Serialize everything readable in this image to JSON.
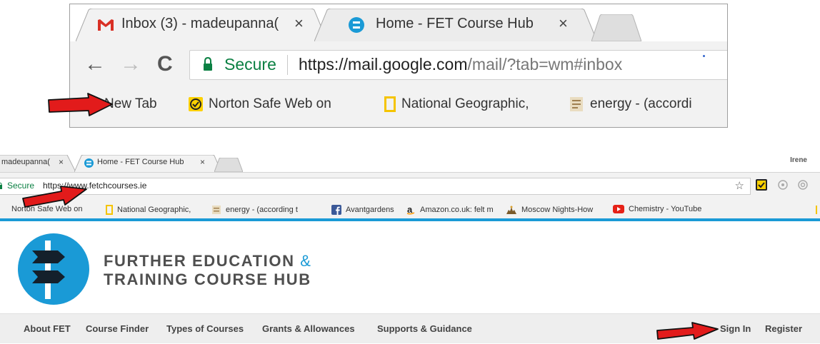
{
  "zoom_browser": {
    "tabs": [
      {
        "icon": "gmail-icon",
        "title": "Inbox (3) - madeupanna(",
        "close": "×"
      },
      {
        "icon": "fet-icon",
        "title": "Home - FET Course Hub",
        "close": "×"
      }
    ],
    "nav": {
      "back": "←",
      "forward": "→",
      "reload": "C"
    },
    "omnibox": {
      "secure_label": "Secure",
      "url_host": "https://mail.google.com",
      "url_path": "/mail/?tab=wm#inbox"
    },
    "bookmarks": [
      {
        "icon": "chrome-icon",
        "label": "New Tab"
      },
      {
        "icon": "norton-icon",
        "label": "Norton Safe Web on"
      },
      {
        "icon": "natgeo-icon",
        "label": "National Geographic,"
      },
      {
        "icon": "book-icon",
        "label": "energy - (accordi"
      }
    ]
  },
  "site_browser": {
    "tabs": [
      {
        "title": "madeupanna(",
        "close": "×"
      },
      {
        "icon": "fet-icon",
        "title": "Home - FET Course Hub",
        "close": "×"
      }
    ],
    "user": "Irene",
    "omnibox": {
      "secure_label": "Secure",
      "url": "https://www.fetchcourses.ie",
      "star": "☆"
    },
    "bookmarks": [
      {
        "label": "Norton Safe Web on"
      },
      {
        "icon": "natgeo-icon",
        "label": "National Geographic,"
      },
      {
        "icon": "book-icon",
        "label": "energy - (according t"
      },
      {
        "icon": "facebook-icon",
        "label": "Avantgardens"
      },
      {
        "icon": "amazon-icon",
        "label": "Amazon.co.uk: felt m"
      },
      {
        "icon": "moscow-icon",
        "label": "Moscow Nights-How"
      },
      {
        "icon": "youtube-icon",
        "label": "Chemistry - YouTube"
      }
    ],
    "brand": {
      "line1": "FURTHER EDUCATION",
      "amp": "&",
      "line2": "TRAINING COURSE HUB"
    },
    "nav_left": [
      "About FET",
      "Course Finder",
      "Types of Courses",
      "Grants & Allowances",
      "Supports & Guidance"
    ],
    "nav_right": [
      "Sign In",
      "Register"
    ]
  },
  "colors": {
    "accent": "#1a9ad6",
    "secure": "#0b8043",
    "arrow": "#e21b1b"
  }
}
